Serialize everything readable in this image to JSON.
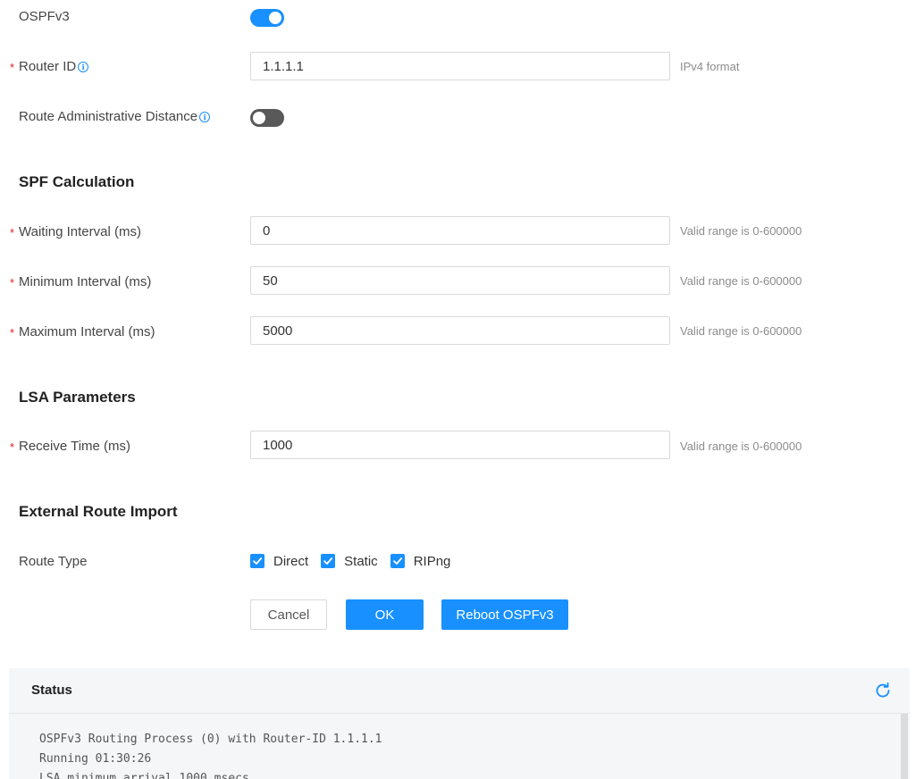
{
  "ospfv3": {
    "label": "OSPFv3",
    "enabled": true
  },
  "router_id": {
    "label": "Router ID",
    "value": "1.1.1.1",
    "hint": "IPv4 format"
  },
  "route_admin_distance": {
    "label": "Route Administrative Distance",
    "enabled": false
  },
  "spf": {
    "title": "SPF Calculation",
    "waiting": {
      "label": "Waiting Interval (ms)",
      "value": "0",
      "hint": "Valid range is 0-600000"
    },
    "minimum": {
      "label": "Minimum Interval (ms)",
      "value": "50",
      "hint": "Valid range is 0-600000"
    },
    "maximum": {
      "label": "Maximum Interval (ms)",
      "value": "5000",
      "hint": "Valid range is 0-600000"
    }
  },
  "lsa": {
    "title": "LSA Parameters",
    "receive": {
      "label": "Receive Time (ms)",
      "value": "1000",
      "hint": "Valid range is 0-600000"
    }
  },
  "external": {
    "title": "External Route Import",
    "route_type_label": "Route Type",
    "options": [
      {
        "label": "Direct",
        "checked": true
      },
      {
        "label": "Static",
        "checked": true
      },
      {
        "label": "RIPng",
        "checked": true
      }
    ]
  },
  "buttons": {
    "cancel": "Cancel",
    "ok": "OK",
    "reboot": "Reboot OSPFv3"
  },
  "status": {
    "title": "Status",
    "lines": [
      "OSPFv3 Routing Process (0) with Router-ID 1.1.1.1",
      "Running 01:30:26",
      "LSA minimum arrival 1000 msecs"
    ]
  },
  "colors": {
    "accent": "#1890ff",
    "required": "#e02020",
    "toggle_off": "#595959"
  },
  "icons": {
    "info": "info-circle-icon",
    "refresh": "refresh-icon",
    "check": "check-icon"
  }
}
